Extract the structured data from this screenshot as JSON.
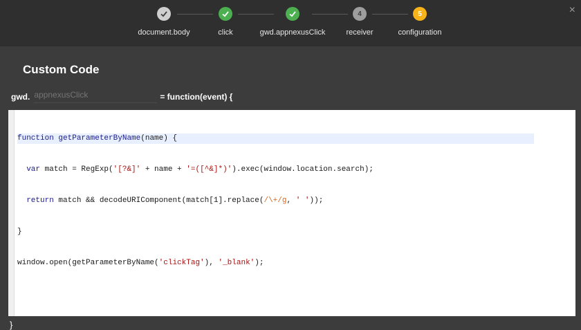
{
  "steps": [
    {
      "label": "document.body",
      "state": "done-grey",
      "marker": "✓"
    },
    {
      "label": "click",
      "state": "done-green",
      "marker": "✓"
    },
    {
      "label": "gwd.appnexusClick",
      "state": "done-green",
      "marker": "✓"
    },
    {
      "label": "receiver",
      "state": "num-grey",
      "marker": "4"
    },
    {
      "label": "configuration",
      "state": "active",
      "marker": "5"
    }
  ],
  "close_icon": "×",
  "title": "Custom Code",
  "signature": {
    "prefix": "gwd.",
    "function_name_placeholder": "appnexusClick",
    "suffix": "= function(event) {"
  },
  "code_lines": [
    "function getParameterByName(name) {",
    "  var match = RegExp('[?&]' + name + '=([^&]*)').exec(window.location.search);",
    "  return match && decodeURIComponent(match[1].replace(/\\+/g, ' '));",
    "}",
    "window.open(getParameterByName('clickTag'), '_blank');"
  ],
  "closing_brace": "}",
  "colors": {
    "topbar": "#2f2f2f",
    "background": "#3c3c3c",
    "done_green": "#4caf50",
    "active": "#f9b31a"
  }
}
